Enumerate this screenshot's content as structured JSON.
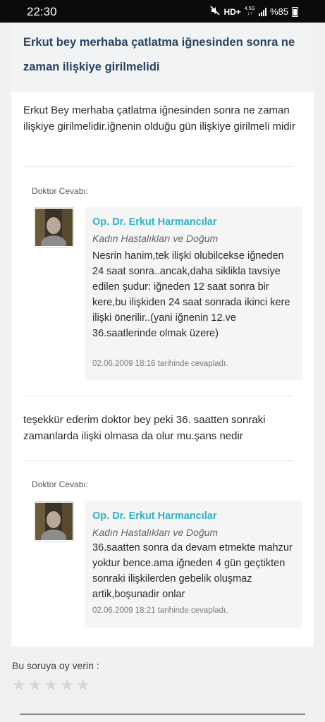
{
  "status": {
    "time": "22:30",
    "network": "HD+",
    "net_top": "4.5G",
    "battery": "%85"
  },
  "question": {
    "title": "Erkut bey merhaba çatlatma iğnesinden sonra ne zaman ilişkiye girilmelidi",
    "body": "Erkut Bey merhaba çatlatma iğnesinden sonra ne zaman ilişkiye girilmelidir.iğnenin olduğu gün ilişkiye girilmeli midir"
  },
  "answers": [
    {
      "label": "Doktor Cevabı:",
      "doctor": "Op. Dr. Erkut Harmancılar",
      "specialty": "Kadın Hastalıkları ve Doğum",
      "text": "Nesrin hanim,tek ilişki olubilcekse iğneden 24 saat sonra..ancak,daha siklikla tavsiye edilen şudur: iğneden 12 saat sonra bir kere,bu ilişkiden 24 saat sonrada ikinci kere ilişki önerilir..(yani iğnenin 12.ve 36.saatlerinde olmak üzere)",
      "date": "02.06.2009 18:16 tarihinde cevapladı."
    },
    {
      "label": "Doktor Cevabı:",
      "doctor": "Op. Dr. Erkut Harmancılar",
      "specialty": "Kadın Hastalıkları ve Doğum",
      "text": "36.saatten sonra da devam etmekte mahzur yoktur bence.ama iğneden 4 gün geçtikten sonraki ilişkilerden gebelik oluşmaz artik,boşunadir onlar",
      "date": "02.06.2009 18:21 tarihinde cevapladı."
    }
  ],
  "followup": "teşekkür ederim doktor bey peki 36. saatten sonraki zamanlarda ilişki olmasa da olur mu.şans nedir",
  "rating": {
    "label": "Bu soruya oy verin :",
    "stars": 5,
    "star_glyph": "★"
  }
}
